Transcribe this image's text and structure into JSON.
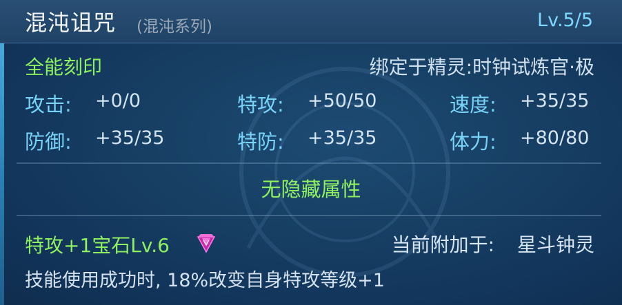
{
  "header": {
    "title": "混沌诅咒",
    "series": "(混沌系列)",
    "level": "Lv.5/5"
  },
  "mark": {
    "type": "全能刻印",
    "bound_to": "绑定于精灵:时钟试炼官·极"
  },
  "stats": [
    {
      "label": "攻击:",
      "value": "+0/0"
    },
    {
      "label": "特攻:",
      "value": "+50/50"
    },
    {
      "label": "速度:",
      "value": "+35/35"
    },
    {
      "label": "防御:",
      "value": "+35/35"
    },
    {
      "label": "特防:",
      "value": "+35/35"
    },
    {
      "label": "体力:",
      "value": "+80/80"
    }
  ],
  "hidden_attribute": "无隐藏属性",
  "gem": {
    "name": "特攻+1宝石Lv.6",
    "icon": "pink-gem-icon",
    "attached_label": "当前附加于:",
    "attached_to": "星斗钟灵",
    "description": "技能使用成功时, 18%改变自身特攻等级+1"
  },
  "colors": {
    "green": "#8ff060",
    "cyan": "#7fd4f6",
    "level": "#7fd8ff",
    "gem": "#e040c8"
  }
}
